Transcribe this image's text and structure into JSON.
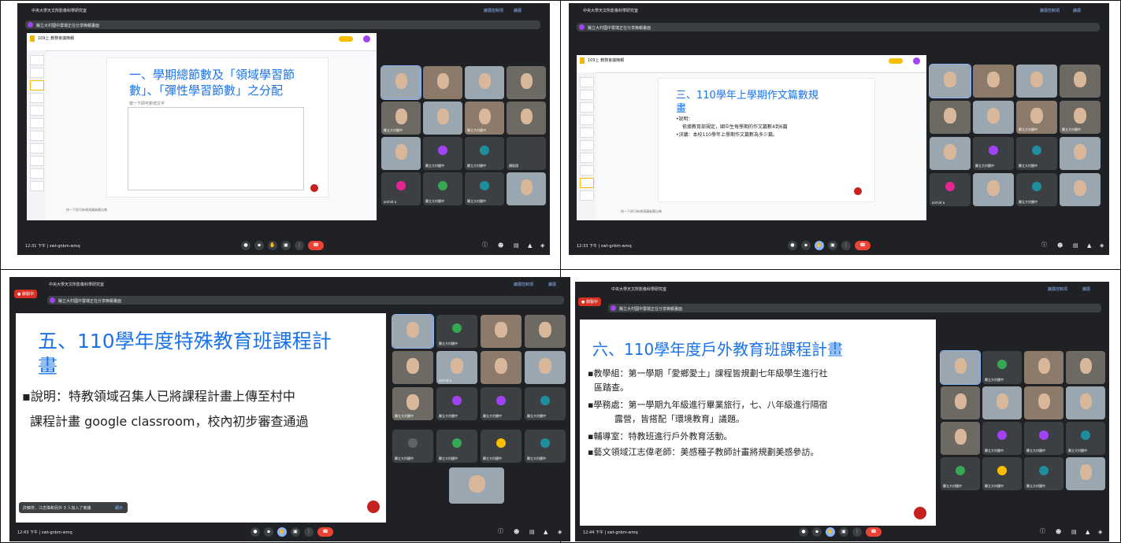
{
  "panels": [
    {
      "meeting_title": "中央大學天文所影像科學研究室",
      "presenter": "縣立大村國中雲端正在分享簡報畫面",
      "top_buttons": [
        "擴展控制項",
        "擴展"
      ],
      "clock": "12:31 下午",
      "code": "swt-gnbm-wmq",
      "slide_title_1": "一、學期總節數及「領域學習節",
      "slide_title_2": "數」、「彈性學習節數」之分配",
      "slide_sub": "按一下即可新增文字",
      "notes": "按一下即可新增演講者備忘稿",
      "doc_name": "109上 教務會議簡報"
    },
    {
      "meeting_title": "中央大學天文所影像科學研究室",
      "presenter": "縣立大村國中雲端正在分享簡報畫面",
      "top_buttons": [
        "擴展控制項",
        "擴展"
      ],
      "clock": "12:33 下午",
      "code": "swt-gnbm-wmq",
      "slide_title_1": "三、110學年上學期作文篇數規",
      "slide_title_2": "畫",
      "bullet_1": "•說明：",
      "bullet_2": "依據教育部規定，國中生每學期的作文篇數4到6篇",
      "bullet_3": "•決議：本校110學年上學期作文篇數為多少篇。",
      "notes": "按一下即可新增演講者備忘稿",
      "doc_name": "109上 教務會議簡報"
    },
    {
      "meeting_title": "中央大學天文所影像科學研究室",
      "presenter": "縣立大村國中雲端正在分享簡報畫面",
      "top_buttons": [
        "擴展控制項",
        "擴展"
      ],
      "recording": "● 錄製中",
      "clock": "12:43 下午",
      "code": "swt-gnbm-wmq",
      "slide_title_1": "五、110學年度特殊教育班課程計",
      "slide_title_2": "畫",
      "line_1": "▪說明：特教領域召集人已將課程計畫上傳至村中",
      "line_2": "課程計畫 google classroom，校內初步審查通過",
      "toast": "許錦芳、江志偉和另外 3 人加入了會議",
      "toast_btn": "顯示"
    },
    {
      "meeting_title": "中央大學天文所影像科學研究室",
      "presenter": "縣立大村國中雲端正在分享簡報畫面",
      "top_buttons": [
        "擴展控制項",
        "擴展"
      ],
      "recording": "● 錄製中",
      "clock": "12:44 下午",
      "code": "swt-gnbm-wmq",
      "slide_title_1": "六、110學年度戶外教育班課程計畫",
      "line_1": "▪教學組：第一學期「愛鄉愛土」課程皆規劃七年級學生進行社",
      "line_2": "區踏查。",
      "line_3": "▪學務處：第一學期九年級進行畢業旅行，七、八年級進行隔宿",
      "line_4": "露營，皆搭配「環境教育」議題。",
      "line_5": "▪輔導室：特教班進行戶外教育活動。",
      "line_6": "▪藝文領域江志偉老師：美感種子教師計畫將規劃美感參訪。"
    }
  ],
  "tile_labels": {
    "school": "縣立大村國中",
    "orchid": "orchid a",
    "user": "顏鈺翔"
  },
  "controls": {
    "mic": "mic-icon",
    "cam": "camera-icon",
    "hand": "raise-hand-icon",
    "present": "present-icon",
    "more": "more-icon",
    "end": "end-call-icon"
  },
  "colors": {
    "meet_bg": "#202124",
    "title_blue": "#1a73e8",
    "end_red": "#ea4335"
  }
}
